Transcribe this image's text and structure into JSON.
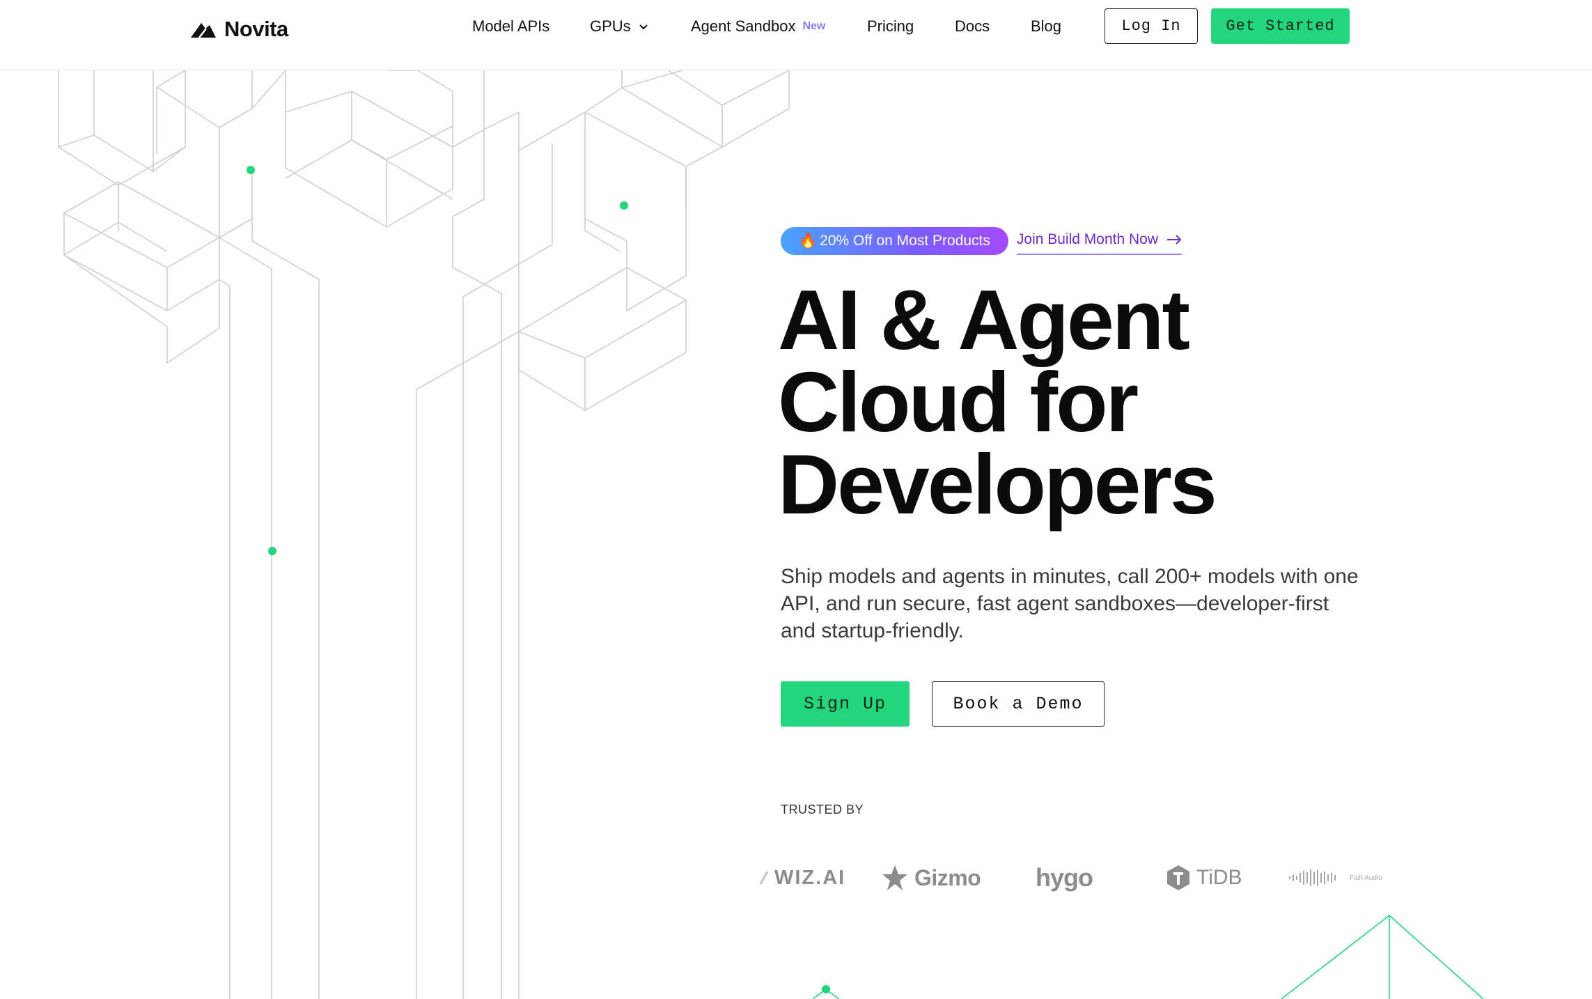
{
  "brand": {
    "name": "Novita",
    "accent": "#23d67d",
    "promo_gradient": [
      "#4aa3ff",
      "#a54bff"
    ]
  },
  "nav": {
    "items": [
      {
        "label": "Model APIs"
      },
      {
        "label": "GPUs",
        "has_dropdown": true
      },
      {
        "label": "Agent Sandbox",
        "badge": "New"
      },
      {
        "label": "Pricing"
      },
      {
        "label": "Docs"
      },
      {
        "label": "Blog"
      }
    ],
    "login_label": "Log In",
    "get_started_label": "Get Started"
  },
  "promo": {
    "badge_icon": "fire-icon",
    "badge_text": "20% Off on Most Products",
    "link_text": "Join Build Month Now"
  },
  "hero": {
    "headline_lines": [
      "AI & Agent",
      "Cloud for",
      "Developers"
    ],
    "subtitle": "Ship models and agents in minutes, call 200+ models with one API, and run secure, fast agent sandboxes—developer-first and startup-friendly.",
    "signup_label": "Sign Up",
    "demo_label": "Book a Demo"
  },
  "trusted": {
    "label": "TRUSTED BY",
    "partners": [
      {
        "name": "WIZ.AI"
      },
      {
        "name": "Gizmo"
      },
      {
        "name": "hygo"
      },
      {
        "name": "TiDB"
      },
      {
        "name": "Fish Audio"
      }
    ]
  }
}
